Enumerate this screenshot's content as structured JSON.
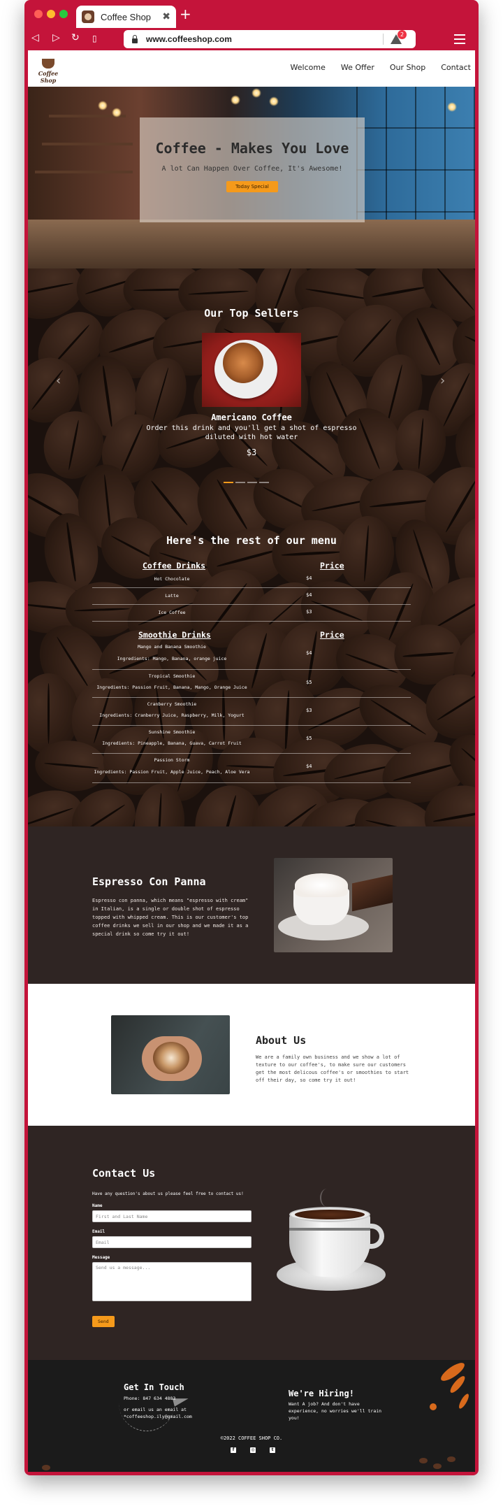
{
  "browser": {
    "tab_title": "Coffee Shop",
    "url": "www.coffeeshop.com",
    "shield_badge": "2",
    "accent_color": "#c4143a"
  },
  "header": {
    "logo_text": "Coffee Shop",
    "nav": [
      "Welcome",
      "We Offer",
      "Our Shop",
      "Contact"
    ]
  },
  "hero": {
    "title": "Coffee - Makes You Love",
    "subtitle": "A lot Can Happen Over Coffee, It's Awesome!",
    "button_label": "Today Special"
  },
  "top_sellers": {
    "title": "Our Top Sellers",
    "product_name": "Americano Coffee",
    "product_description": "Order this drink and you'll get a shot of espresso diluted with hot water",
    "product_price": "$3",
    "prev_arrow": "‹",
    "next_arrow": "›"
  },
  "menu": {
    "title": "Here's the rest of our menu",
    "coffee_header": "Coffee Drinks",
    "coffee_price_header": "Price",
    "coffee_items": [
      {
        "name": "Hot Chocolate",
        "price": "$4"
      },
      {
        "name": "Latte",
        "price": "$4"
      },
      {
        "name": "Ice Coffee",
        "price": "$3"
      }
    ],
    "smoothie_header": "Smoothie Drinks",
    "smoothie_price_header": "Price",
    "smoothie_items": [
      {
        "name": "Mango and Banana Smoothie",
        "ingredients": "Ingredients: Mango, Banana, orange juice",
        "price": "$4"
      },
      {
        "name": "Tropical Smoothie",
        "ingredients": "Ingredients: Passion Fruit, Banana, Mango, Orange Juice",
        "price": "$5"
      },
      {
        "name": "Cranberry Smoothie",
        "ingredients": "Ingredients: Cranberry Juice, Raspberry, Milk, Yogurt",
        "price": "$3"
      },
      {
        "name": "Sunshine Smoothie",
        "ingredients": "Ingredients: Pineapple, Banana, Guava, Carrot Fruit",
        "price": "$5"
      },
      {
        "name": "Passion Storm",
        "ingredients": "Ingredients: Passion Fruit, Apple Juice, Peach, Aloe Vera",
        "price": "$4"
      }
    ]
  },
  "special": {
    "title": "Espresso Con Panna",
    "text": "Espresso con panna, which means \"espresso with cream\" in Italian, is a single or double shot of espresso topped with whipped cream. This is our customer's top coffee drinks we sell in our shop and we made it as a special drink so come try it out!"
  },
  "about": {
    "title": "About Us",
    "text": "We are a family own business and we show a lot of texture to our coffee's, to make sure our customers get the most delicous coffee's or smoothies to start off their day, so come try it out!"
  },
  "contact": {
    "title": "Contact Us",
    "intro": "Have any question's about us please feel free to contact us!",
    "name_label": "Name",
    "name_placeholder": "First and Last Name",
    "email_label": "Email",
    "email_placeholder": "Email",
    "message_label": "Message",
    "message_placeholder": "Send us a message...",
    "send_label": "Send"
  },
  "footer": {
    "touch_title": "Get In Touch",
    "phone": "Phone: 847 634 4883",
    "email_line": "or email us an email at",
    "email": "*coffeeshop.ily@gmail.com",
    "hiring_title": "We're Hiring!",
    "hiring_text": "Want A job? And don't have experience, no worries we'll train you!",
    "copyright": "©2022 COFFEE SHOP CO.",
    "socials": [
      "facebook-icon",
      "instagram-icon",
      "twitter-icon"
    ]
  }
}
